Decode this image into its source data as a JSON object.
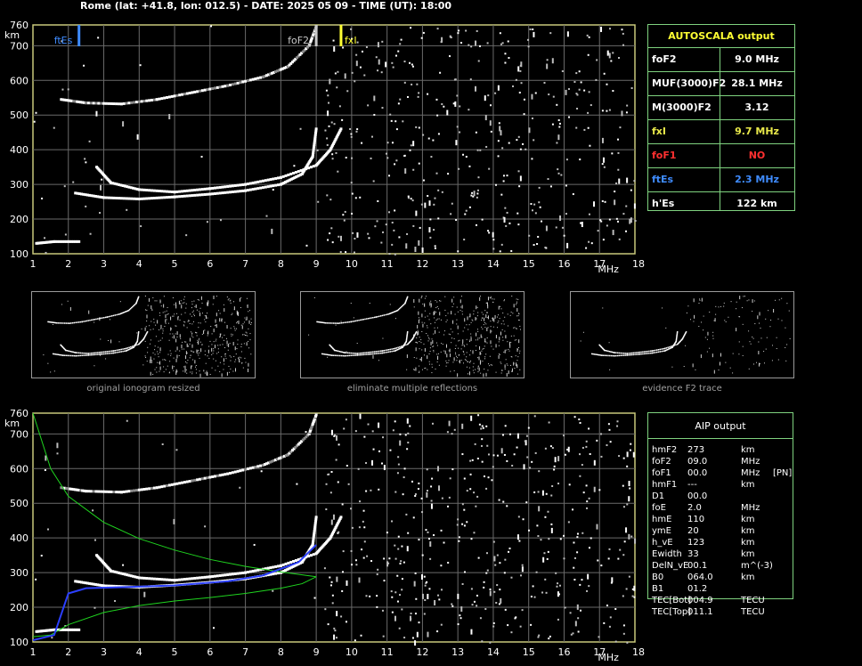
{
  "header": "Rome (lat: +41.8, lon: 012.5) - DATE: 2025 05 09 - TIME (UT): 18:00",
  "ionogram": {
    "x_ticks": [
      "1",
      "2",
      "3",
      "4",
      "5",
      "6",
      "7",
      "8",
      "9",
      "10",
      "11",
      "12",
      "13",
      "14",
      "15",
      "16",
      "17",
      "18"
    ],
    "x_unit": "MHz",
    "y_ticks": [
      "760",
      "700",
      "600",
      "500",
      "400",
      "300",
      "200",
      "100"
    ],
    "y_unit": "km",
    "markers": {
      "ftEs": "ftEs",
      "foF2": "foF2",
      "fxI": "fxI"
    }
  },
  "thumbnails": [
    {
      "caption": "original ionogram resized"
    },
    {
      "caption": "eliminate multiple reflections"
    },
    {
      "caption": "evidence F2 trace"
    }
  ],
  "autoscala": {
    "title": "AUTOSCALA output",
    "rows": [
      {
        "key": "foF2",
        "value": "9.0 MHz",
        "color": "#ffffff"
      },
      {
        "key": "MUF(3000)F2",
        "value": "28.1 MHz",
        "color": "#ffffff"
      },
      {
        "key": "M(3000)F2",
        "value": "3.12",
        "color": "#ffffff"
      },
      {
        "key": "fxI",
        "value": "9.7 MHz",
        "color": "#e8e84a"
      },
      {
        "key": "foF1",
        "value": "NO",
        "color": "#ff3030"
      },
      {
        "key": "ftEs",
        "value": "2.3 MHz",
        "color": "#3f8cff"
      },
      {
        "key": "h'Es",
        "value": "122    km",
        "color": "#ffffff"
      }
    ]
  },
  "aip": {
    "title": "AIP output",
    "rows": [
      {
        "name": "hmF2",
        "val": "273",
        "unit": "km",
        "flag": ""
      },
      {
        "name": "foF2",
        "val": "09.0",
        "unit": "MHz",
        "flag": ""
      },
      {
        "name": "foF1",
        "val": "00.0",
        "unit": "MHz",
        "flag": "[PN]"
      },
      {
        "name": "hmF1",
        "val": "---",
        "unit": "km",
        "flag": ""
      },
      {
        "name": "D1",
        "val": "00.0",
        "unit": "",
        "flag": ""
      },
      {
        "name": "foE",
        "val": "2.0",
        "unit": "MHz",
        "flag": ""
      },
      {
        "name": "hmE",
        "val": "110",
        "unit": "km",
        "flag": ""
      },
      {
        "name": "ymE",
        "val": "20",
        "unit": "km",
        "flag": ""
      },
      {
        "name": "h_vE",
        "val": "123",
        "unit": "km",
        "flag": ""
      },
      {
        "name": "Ewidth",
        "val": "33",
        "unit": "km",
        "flag": ""
      },
      {
        "name": "DelN_vE",
        "val": "00.1",
        "unit": "m^(-3)",
        "flag": ""
      },
      {
        "name": "B0",
        "val": "064.0",
        "unit": "km",
        "flag": ""
      },
      {
        "name": "B1",
        "val": "01.2",
        "unit": "",
        "flag": ""
      },
      {
        "name": "TEC[Bot]",
        "val": "004.9",
        "unit": "TECU",
        "flag": ""
      },
      {
        "name": "TEC[Top]",
        "val": "011.1",
        "unit": "TECU",
        "flag": ""
      }
    ]
  },
  "chart_data": [
    {
      "type": "scatter",
      "xlabel": "MHz",
      "ylabel": "km",
      "xlim": [
        1,
        18
      ],
      "ylim": [
        100,
        760
      ],
      "grid": true,
      "series": [
        {
          "name": "foF2",
          "values": [
            9.0
          ]
        },
        {
          "name": "fxI",
          "values": [
            9.7
          ]
        },
        {
          "name": "ftEs",
          "values": [
            2.3
          ]
        }
      ],
      "traces": {
        "upper_o": [
          [
            1.8,
            545
          ],
          [
            2.5,
            535
          ],
          [
            3.5,
            532
          ],
          [
            4.5,
            545
          ],
          [
            5.5,
            565
          ],
          [
            6.5,
            585
          ],
          [
            7.5,
            610
          ],
          [
            8.2,
            640
          ],
          [
            8.8,
            700
          ],
          [
            9.0,
            755
          ]
        ],
        "F2_o": [
          [
            2.2,
            275
          ],
          [
            3.0,
            262
          ],
          [
            4.0,
            258
          ],
          [
            5.0,
            264
          ],
          [
            6.0,
            272
          ],
          [
            7.0,
            282
          ],
          [
            8.0,
            300
          ],
          [
            8.6,
            330
          ],
          [
            8.9,
            380
          ],
          [
            9.0,
            460
          ]
        ],
        "F2_x": [
          [
            2.8,
            350
          ],
          [
            3.2,
            305
          ],
          [
            4.0,
            285
          ],
          [
            5.0,
            278
          ],
          [
            6.0,
            288
          ],
          [
            7.0,
            300
          ],
          [
            8.0,
            320
          ],
          [
            9.0,
            355
          ],
          [
            9.4,
            400
          ],
          [
            9.7,
            460
          ]
        ],
        "Es": [
          [
            1.1,
            130
          ],
          [
            1.6,
            135
          ],
          [
            2.3,
            135
          ]
        ]
      },
      "profile": {
        "green_bottom": [
          [
            1.0,
            115
          ],
          [
            1.5,
            120
          ],
          [
            2.0,
            150
          ],
          [
            3.0,
            185
          ],
          [
            4.0,
            205
          ],
          [
            5.0,
            218
          ],
          [
            6.0,
            228
          ],
          [
            7.0,
            240
          ],
          [
            8.0,
            255
          ],
          [
            8.6,
            268
          ],
          [
            9.0,
            288
          ]
        ],
        "green_top": [
          [
            1.0,
            760
          ],
          [
            1.5,
            600
          ],
          [
            2.0,
            520
          ],
          [
            3.0,
            445
          ],
          [
            4.0,
            398
          ],
          [
            5.0,
            365
          ],
          [
            6.0,
            338
          ],
          [
            7.0,
            318
          ],
          [
            8.0,
            302
          ],
          [
            9.0,
            288
          ]
        ],
        "blue": [
          [
            1.0,
            105
          ],
          [
            1.6,
            120
          ],
          [
            2.0,
            240
          ],
          [
            2.5,
            255
          ],
          [
            3.5,
            258
          ],
          [
            5.0,
            263
          ],
          [
            6.5,
            275
          ],
          [
            7.5,
            292
          ],
          [
            8.5,
            330
          ],
          [
            9.0,
            380
          ]
        ]
      }
    }
  ]
}
